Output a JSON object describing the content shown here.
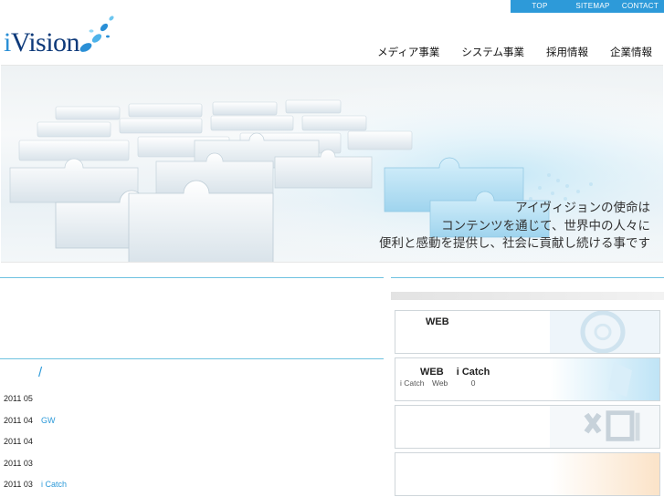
{
  "header": {
    "logo_letter": "i",
    "logo_word": "Vision",
    "util_nav": {
      "top": "TOP",
      "sitemap": "SITEMAP",
      "contact": "CONTACT"
    },
    "main_nav": [
      "メディア事業",
      "システム事業",
      "採用情報",
      "企業情報"
    ]
  },
  "hero": {
    "message_lines": [
      "アイヴィジョンの使命は",
      "コンテンツを通じて、世界中の人々に",
      "便利と感動を提供し、社会に貢献し続ける事です"
    ]
  },
  "news": {
    "slash": "/",
    "items": [
      {
        "date": "2011 05",
        "title": ""
      },
      {
        "date": "2011 04",
        "title": "GW"
      },
      {
        "date": "2011 04",
        "title": ""
      },
      {
        "date": "2011 03",
        "title": ""
      },
      {
        "date": "2011 03",
        "title": "i Catch"
      }
    ]
  },
  "banners": [
    {
      "title": "WEB",
      "sub": ""
    },
    {
      "title": "WEB　 i Catch",
      "sub": "i Catch　Web　　　0"
    },
    {
      "title": "",
      "sub": ""
    },
    {
      "title": "",
      "sub": ""
    }
  ],
  "colors": {
    "accent": "#2d9ad9",
    "rule": "#6ec2e0",
    "logo_dark": "#0e3a7a"
  }
}
